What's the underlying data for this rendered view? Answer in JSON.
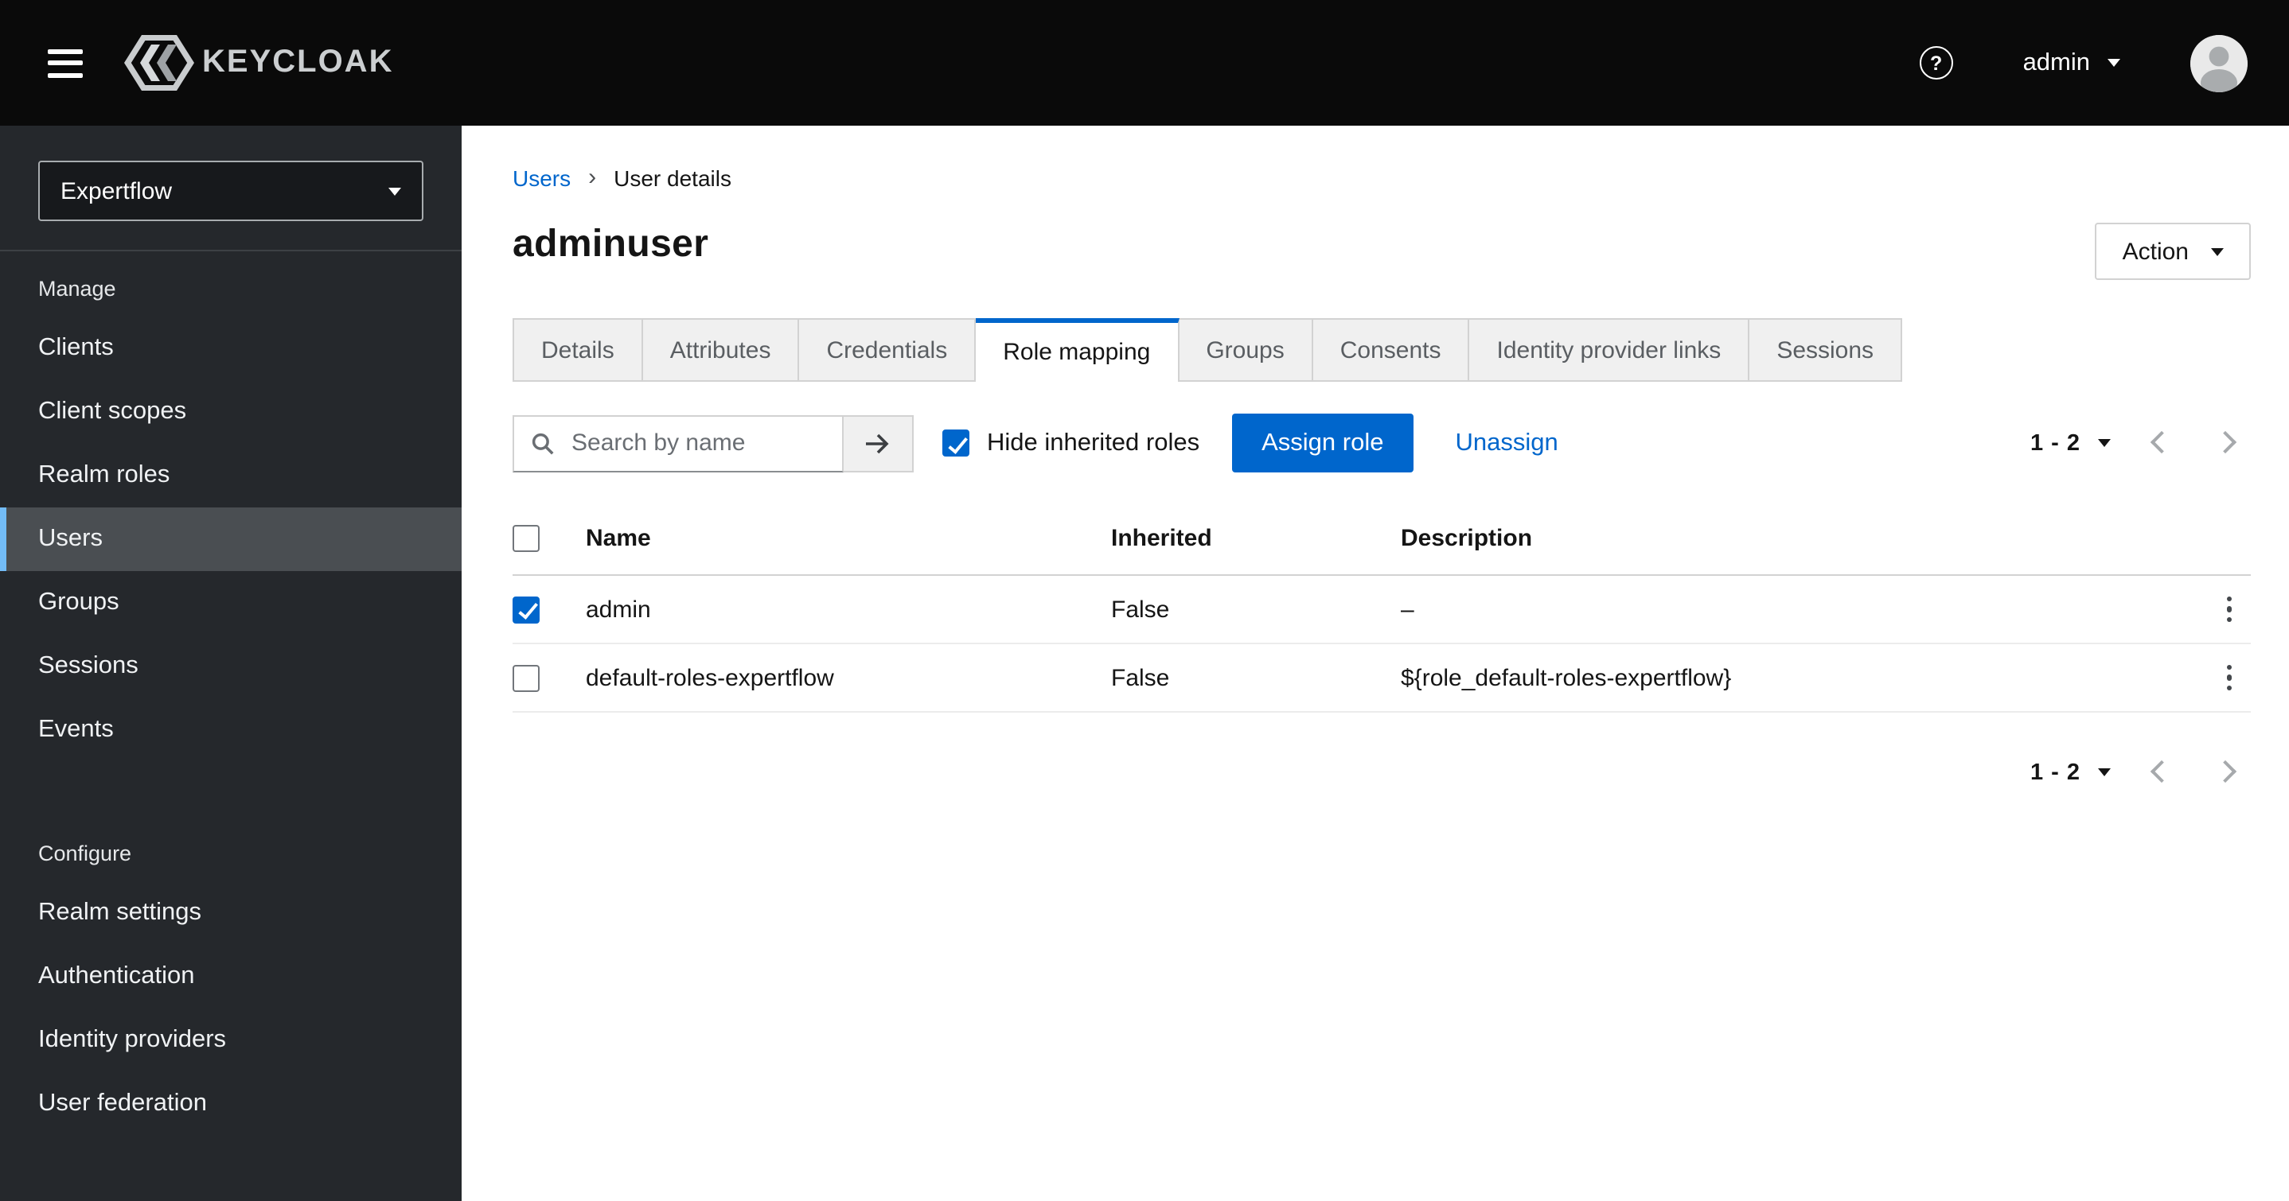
{
  "colors": {
    "primary": "#0066cc",
    "link": "#0066cc",
    "header_bg": "#0a0a0a",
    "sidebar_bg": "#25282c",
    "sidebar_active_bg": "#4a4e52",
    "sidebar_active_indicator": "#73bcf7",
    "active_tab_indicator": "#0066cc",
    "checkbox_checked": "#0066cc"
  },
  "header": {
    "brand": "KEYCLOAK",
    "help_glyph": "?",
    "user_label": "admin"
  },
  "sidebar": {
    "realm_selector": {
      "value": "Expertflow"
    },
    "sections": [
      {
        "label": "Manage",
        "items": [
          {
            "label": "Clients"
          },
          {
            "label": "Client scopes"
          },
          {
            "label": "Realm roles"
          },
          {
            "label": "Users",
            "active": true
          },
          {
            "label": "Groups"
          },
          {
            "label": "Sessions"
          },
          {
            "label": "Events"
          }
        ]
      },
      {
        "label": "Configure",
        "items": [
          {
            "label": "Realm settings"
          },
          {
            "label": "Authentication"
          },
          {
            "label": "Identity providers"
          },
          {
            "label": "User federation"
          }
        ]
      }
    ]
  },
  "breadcrumb": {
    "items": [
      {
        "label": "Users"
      },
      {
        "label": "User details"
      }
    ],
    "separator": "›"
  },
  "page": {
    "title": "adminuser",
    "action_label": "Action"
  },
  "tabs": {
    "items": [
      {
        "label": "Details"
      },
      {
        "label": "Attributes"
      },
      {
        "label": "Credentials"
      },
      {
        "label": "Role mapping",
        "active": true
      },
      {
        "label": "Groups"
      },
      {
        "label": "Consents"
      },
      {
        "label": "Identity provider links"
      },
      {
        "label": "Sessions"
      }
    ]
  },
  "toolbar": {
    "search_placeholder": "Search by name",
    "search_value": "",
    "hide_inherited_label": "Hide inherited roles",
    "hide_inherited_checked": true,
    "assign_label": "Assign role",
    "unassign_label": "Unassign"
  },
  "pagination": {
    "range": "1 - 2"
  },
  "table": {
    "columns": [
      {
        "label": "Name"
      },
      {
        "label": "Inherited"
      },
      {
        "label": "Description"
      }
    ],
    "header_checked": false,
    "rows": [
      {
        "checked": true,
        "name": "admin",
        "inherited": "False",
        "description": "–"
      },
      {
        "checked": false,
        "name": "default-roles-expertflow",
        "inherited": "False",
        "description": "${role_default-roles-expertflow}"
      }
    ]
  }
}
